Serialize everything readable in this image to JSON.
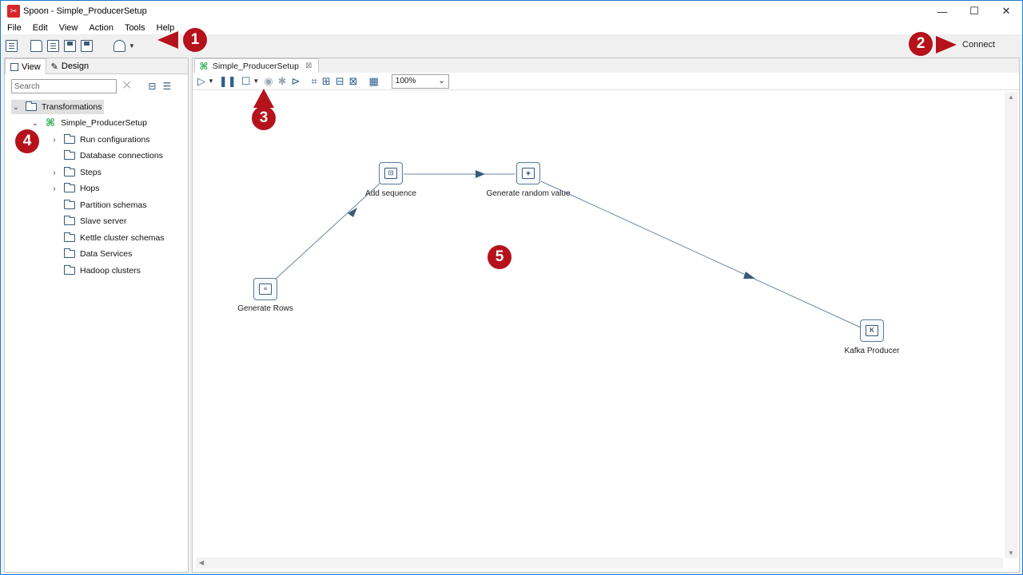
{
  "window": {
    "title": "Spoon - Simple_ProducerSetup",
    "app_icon": "spoon-icon",
    "controls": {
      "minimize": "—",
      "maximize": "☐",
      "close": "✕"
    }
  },
  "menu": [
    "File",
    "Edit",
    "View",
    "Action",
    "Tools",
    "Help"
  ],
  "toolbar": {
    "connect_label": "Connect"
  },
  "left_panel": {
    "tabs": [
      {
        "label": "View",
        "active": true
      },
      {
        "label": "Design",
        "active": false
      }
    ],
    "search_placeholder": "Search",
    "tree": {
      "root": "Transformations",
      "transformation": "Simple_ProducerSetup",
      "items": [
        {
          "label": "Run configurations",
          "expandable": true
        },
        {
          "label": "Database connections",
          "expandable": false
        },
        {
          "label": "Steps",
          "expandable": true
        },
        {
          "label": "Hops",
          "expandable": true
        },
        {
          "label": "Partition schemas",
          "expandable": false
        },
        {
          "label": "Slave server",
          "expandable": false
        },
        {
          "label": "Kettle cluster schemas",
          "expandable": false
        },
        {
          "label": "Data Services",
          "expandable": false
        },
        {
          "label": "Hadoop clusters",
          "expandable": false
        }
      ]
    }
  },
  "editor": {
    "tab_label": "Simple_ProducerSetup",
    "zoom": "100%",
    "steps": [
      {
        "id": "generate-rows",
        "label": "Generate Rows",
        "glyph": "≡"
      },
      {
        "id": "add-sequence",
        "label": "Add sequence",
        "glyph": "⊡"
      },
      {
        "id": "generate-random-value",
        "label": "Generate random value",
        "glyph": "◈"
      },
      {
        "id": "kafka-producer",
        "label": "Kafka Producer",
        "glyph": "K"
      }
    ]
  },
  "callouts": [
    "1",
    "2",
    "3",
    "4",
    "5"
  ],
  "colors": {
    "callout": "#b5121b",
    "hop_line": "#5a7a99",
    "hop_arrow": "#3a5a7a",
    "transformation_icon": "#2aa84a",
    "app_icon": "#d7262b"
  }
}
